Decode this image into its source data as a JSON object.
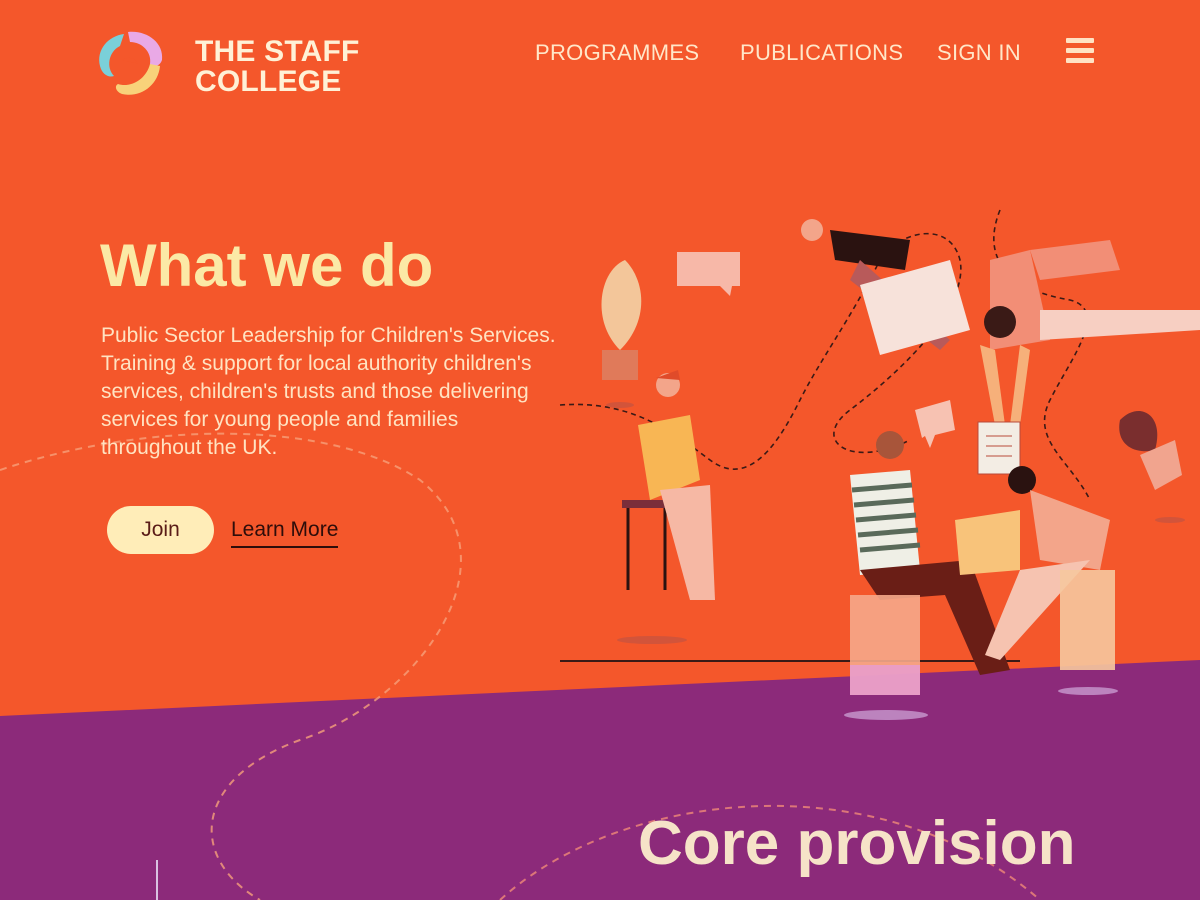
{
  "brand": {
    "line1": "THE STAFF",
    "line2": "COLLEGE"
  },
  "nav": {
    "items": [
      {
        "label": "PROGRAMMES"
      },
      {
        "label": "PUBLICATIONS"
      },
      {
        "label": "SIGN IN"
      }
    ],
    "menu_icon": "hamburger-menu-icon"
  },
  "hero": {
    "title": "What we do",
    "description": "Public Sector Leadership for Children's Services.  Training & support for local authority children's services, children's trusts and those delivering services for young people and families throughout the UK.",
    "join_label": "Join",
    "learn_more_label": "Learn More"
  },
  "section": {
    "title": "Core provision"
  },
  "colors": {
    "hero_bg": "#F4572B",
    "section_bg": "#8C2A7A",
    "hero_title": "#FBE9A6",
    "button_bg": "#FFEDB8"
  }
}
